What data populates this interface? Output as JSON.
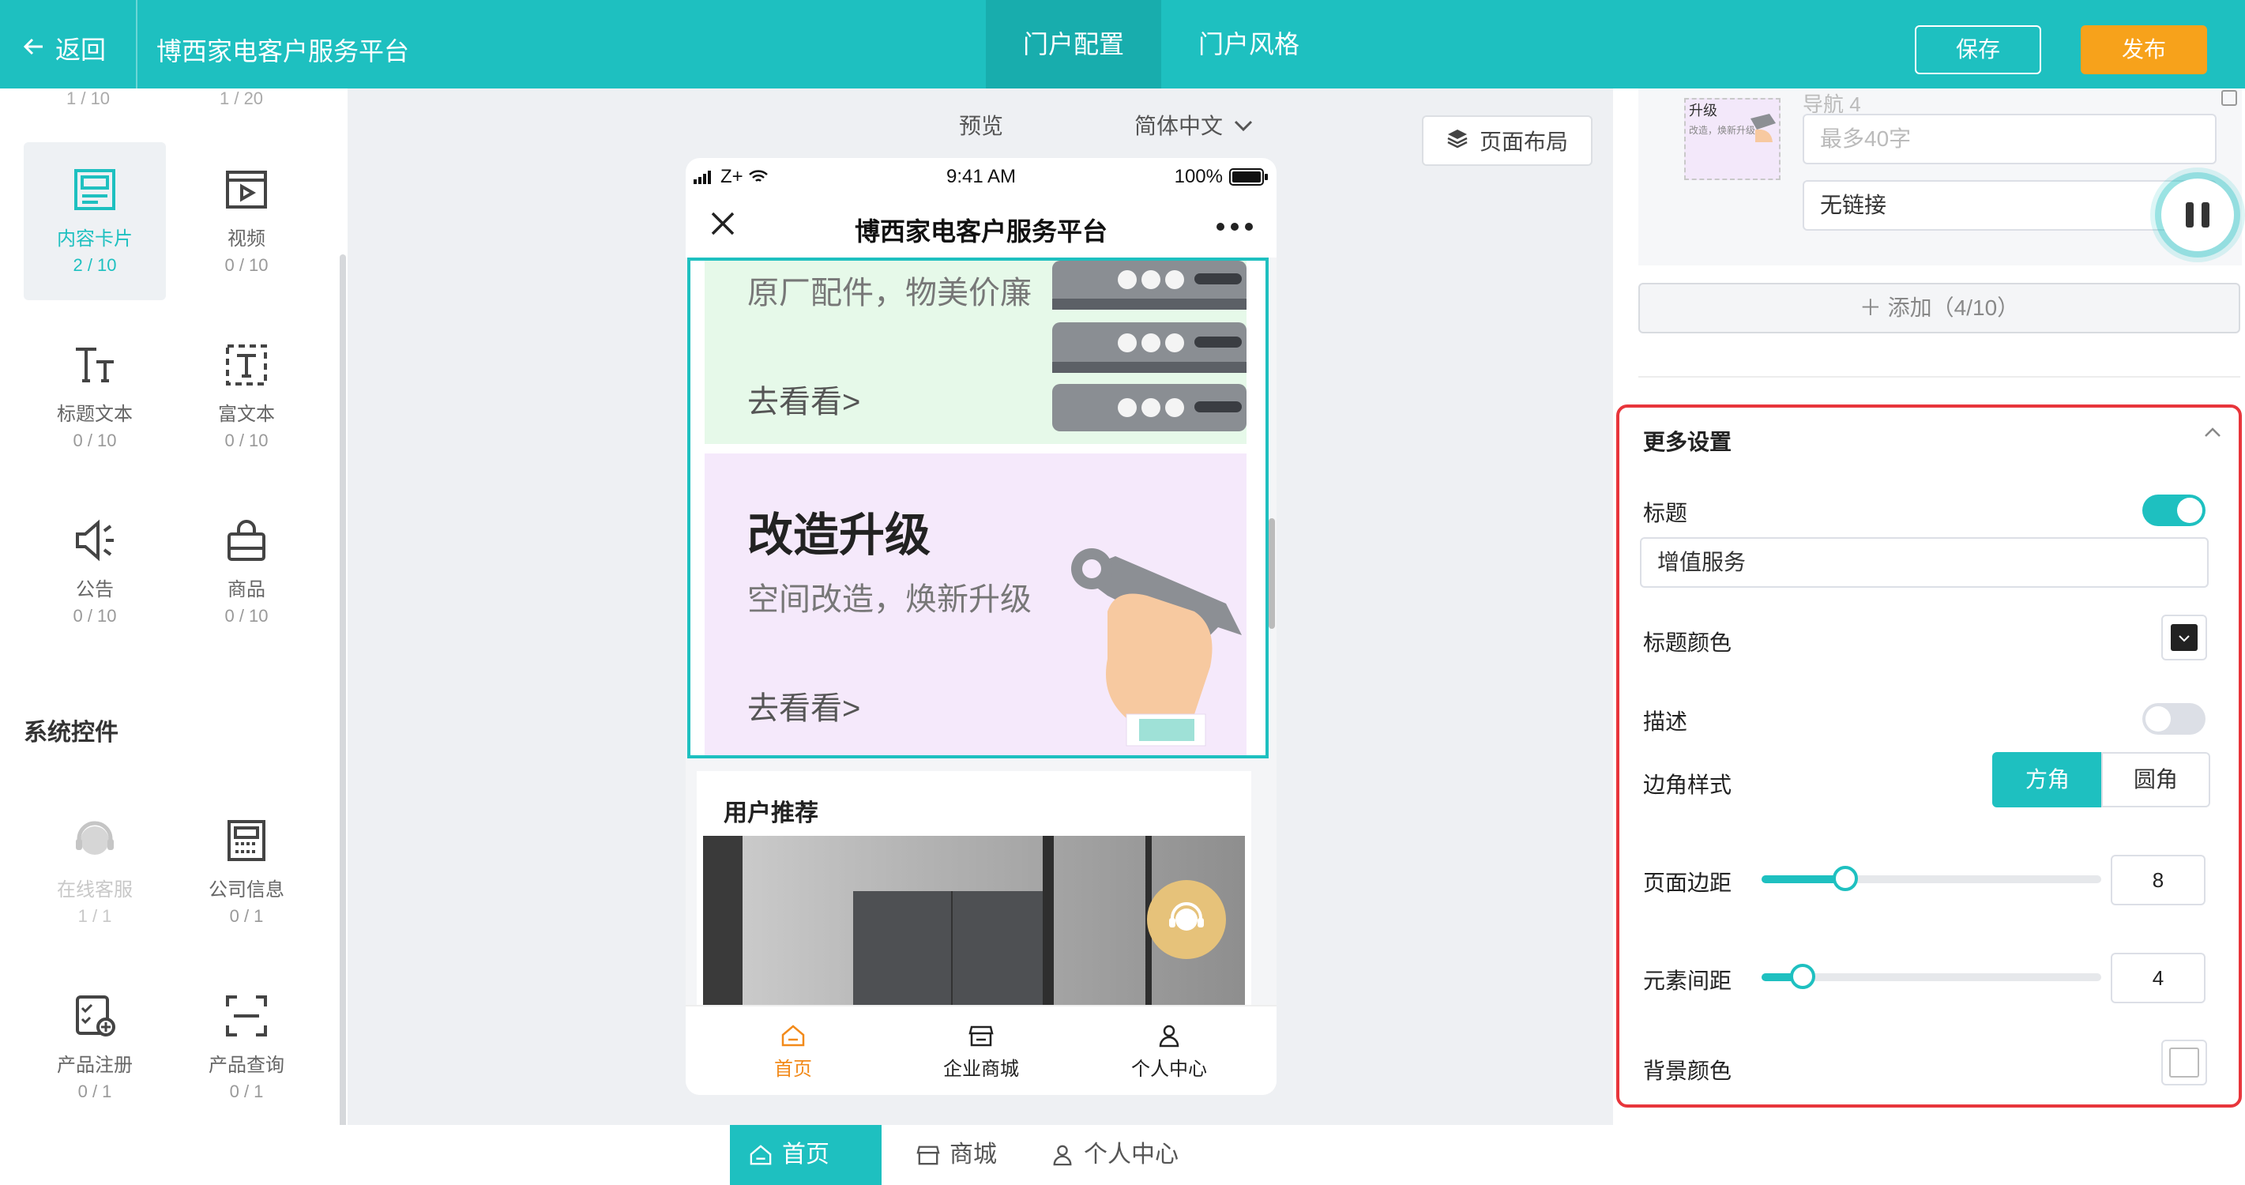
{
  "topbar": {
    "back_label": "返回",
    "app_title": "博西家电客户服务平台",
    "tabs": [
      {
        "label": "门户配置"
      },
      {
        "label": "门户风格"
      }
    ],
    "save_label": "保存",
    "publish_label": "发布"
  },
  "left_panel": {
    "top_counts": [
      "1 / 10",
      "1 / 20"
    ],
    "components": [
      {
        "label": "内容卡片",
        "count": "2 / 10"
      },
      {
        "label": "视频",
        "count": "0 / 10"
      },
      {
        "label": "标题文本",
        "count": "0 / 10"
      },
      {
        "label": "富文本",
        "count": "0 / 10"
      },
      {
        "label": "公告",
        "count": "0 / 10"
      },
      {
        "label": "商品",
        "count": "0 / 10"
      }
    ],
    "system_title": "系统控件",
    "system_components": [
      {
        "label": "在线客服",
        "count": "1 / 1"
      },
      {
        "label": "公司信息",
        "count": "0 / 1"
      },
      {
        "label": "产品注册",
        "count": "0 / 1"
      },
      {
        "label": "产品查询",
        "count": "0 / 1"
      }
    ]
  },
  "center": {
    "preview_label": "预览",
    "language": "简体中文",
    "layout_button": "页面布局",
    "phone": {
      "carrier": "Z+",
      "time": "9:41 AM",
      "battery": "100%",
      "title": "博西家电客户服务平台",
      "card1": {
        "subtitle": "原厂配件，物美价廉",
        "link": "去看看>"
      },
      "card2": {
        "title": "改造升级",
        "subtitle": "空间改造，焕新升级",
        "link": "去看看>"
      },
      "recommend_title": "用户推荐",
      "tabbar": [
        {
          "label": "首页"
        },
        {
          "label": "企业商城"
        },
        {
          "label": "个人中心"
        }
      ]
    },
    "bottom_nav": [
      {
        "label": "首页"
      },
      {
        "label": "商城"
      },
      {
        "label": "个人中心"
      }
    ]
  },
  "right_panel": {
    "nav_item_label": "导航 4",
    "thumb_text": "升级",
    "thumb_sub": "改造，焕新升级",
    "title_placeholder": "最多40字",
    "link_value": "无链接",
    "add_button": "＋ 添加（4/10）",
    "more_settings": {
      "header": "更多设置",
      "title_label": "标题",
      "title_enabled": true,
      "title_value": "增值服务",
      "title_color_label": "标题颜色",
      "title_color": "#222222",
      "desc_label": "描述",
      "desc_enabled": false,
      "corner_label": "边角样式",
      "corner_options": [
        "方角",
        "圆角"
      ],
      "corner_selected": "方角",
      "page_margin_label": "页面边距",
      "page_margin_value": "8",
      "element_spacing_label": "元素间距",
      "element_spacing_value": "4",
      "bg_color_label": "背景颜色",
      "bg_color": "#ffffff"
    }
  },
  "colors": {
    "accent": "#1ec0c0",
    "publish": "#f7a21b",
    "highlight_border": "#e8353b",
    "tab_active": "#f28a1a"
  }
}
